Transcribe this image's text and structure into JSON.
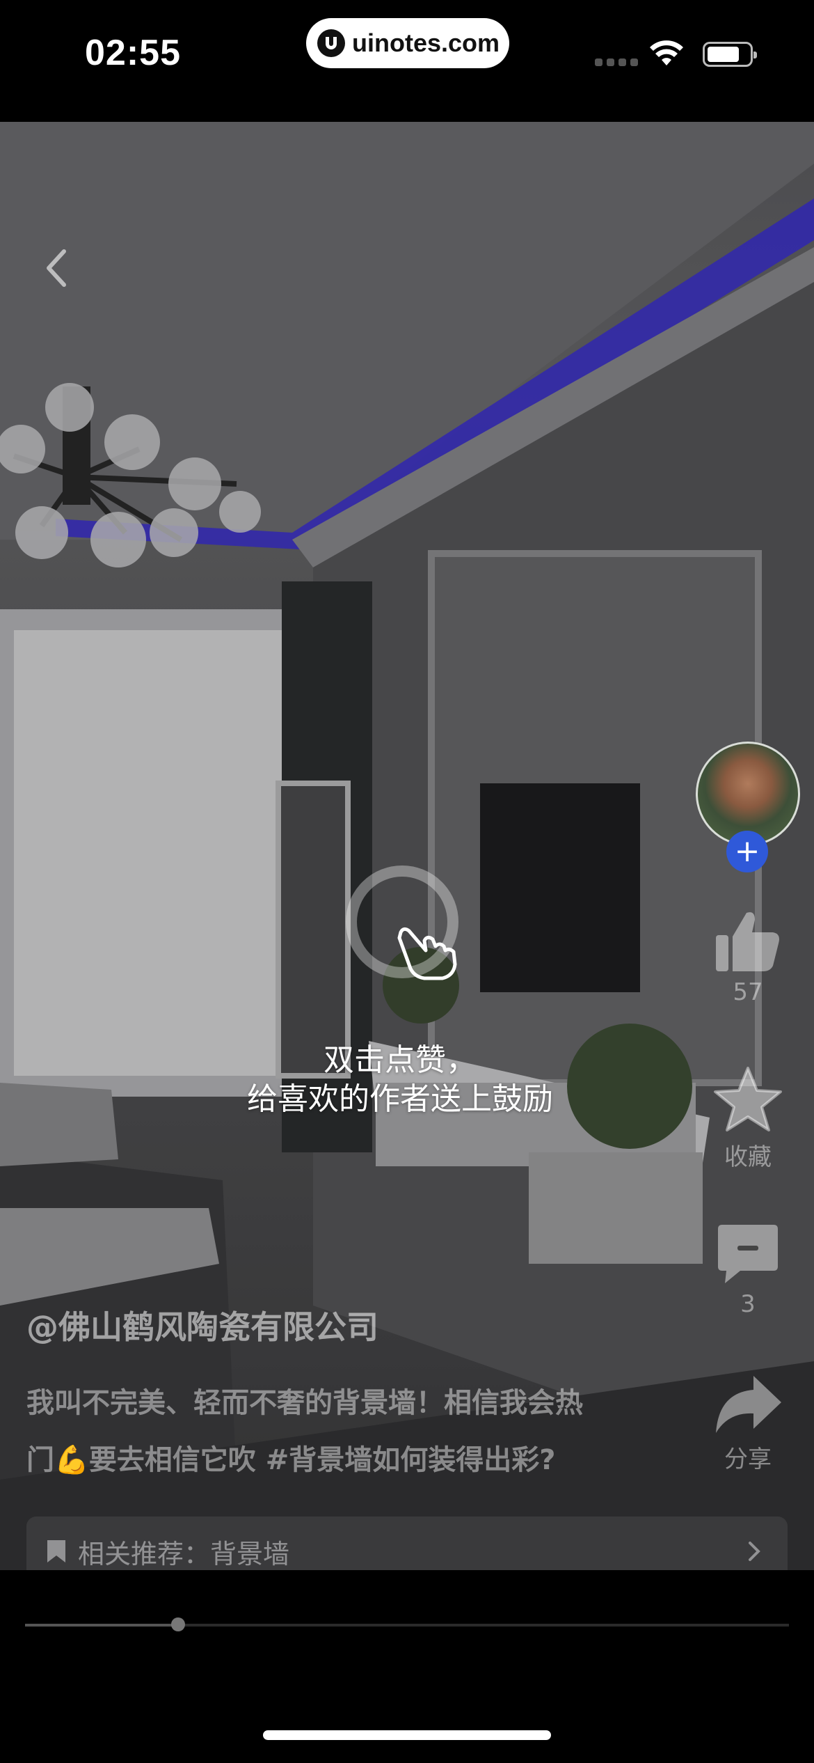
{
  "status_bar": {
    "time": "02:55",
    "site": "uinotes.com",
    "battery_level": 0.75
  },
  "icons": {
    "back": "chevron-left-icon",
    "tap_hint": "hand-pointer-icon",
    "like": "thumbs-up-icon",
    "favorite": "star-icon",
    "comment": "comment-icon",
    "share": "share-icon",
    "related": "bookmark-icon"
  },
  "hint": {
    "line1": "双击点赞，",
    "line2": "给喜欢的作者送上鼓励"
  },
  "actions": {
    "follow_symbol": "+",
    "like_count": "57",
    "favorite_label": "收藏",
    "comment_count": "3",
    "share_label": "分享"
  },
  "post": {
    "author": "@佛山鹤风陶瓷有限公司",
    "desc_line1": "我叫不完美、轻而不奢的背景墙！相信我会热",
    "desc_line2_a": "门",
    "desc_line2_emoji": "💪",
    "desc_line2_b": "要去相信它吹  #背景墙如何装得出彩?",
    "related": "相关推荐：背景墙"
  },
  "player": {
    "progress": 0.2
  },
  "colors": {
    "follow": "#2f59d9",
    "ceiling_light": "#3b2fd6"
  }
}
